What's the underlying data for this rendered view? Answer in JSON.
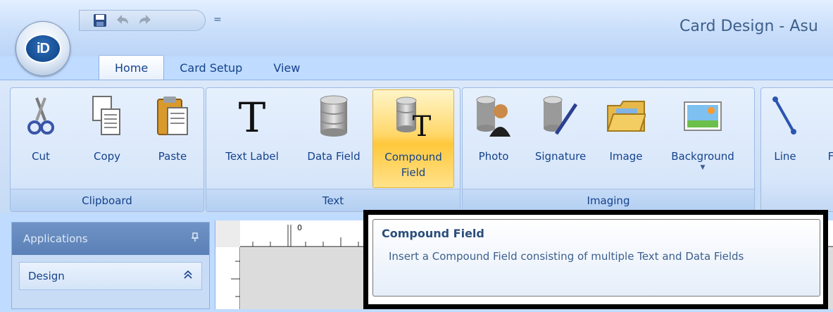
{
  "app": {
    "logo_text": "iD",
    "window_title": "Card Design - Asu"
  },
  "quick_access": {
    "items": [
      "save-icon",
      "undo-icon",
      "redo-icon"
    ],
    "more_glyph": "="
  },
  "tabs": [
    {
      "label": "Home",
      "active": true
    },
    {
      "label": "Card Setup",
      "active": false
    },
    {
      "label": "View",
      "active": false
    }
  ],
  "ribbon": {
    "clipboard": {
      "label": "Clipboard",
      "buttons": [
        "Cut",
        "Copy",
        "Paste"
      ]
    },
    "text": {
      "label": "Text",
      "buttons": [
        "Text Label",
        "Data Field",
        "Compound Field"
      ],
      "compound_line1": "Compound",
      "compound_line2": "Field"
    },
    "imaging": {
      "label": "Imaging",
      "buttons": [
        "Photo",
        "Signature",
        "Image",
        "Background"
      ]
    },
    "shapes": {
      "buttons": [
        "Line",
        "F"
      ]
    }
  },
  "left_panel": {
    "header": "Applications",
    "pin_glyph": "ᵖ",
    "section": "Design",
    "collapse_glyph": "≈"
  },
  "ruler": {
    "origin_label": "0"
  },
  "tooltip": {
    "title": "Compound Field",
    "description": "Insert a Compound Field consisting of multiple Text and Data Fields"
  },
  "colors": {
    "accent": "#15428b",
    "hover": "#ffd86b",
    "ribbon_bg": "#dbe8fa"
  }
}
